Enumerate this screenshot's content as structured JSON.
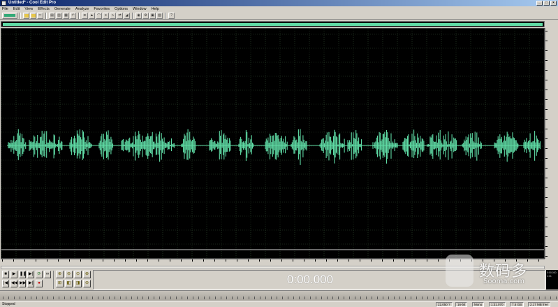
{
  "window": {
    "title": "Untitled* - Cool Edit Pro"
  },
  "menu": [
    "File",
    "Edit",
    "View",
    "Effects",
    "Generate",
    "Analyze",
    "Favorites",
    "Options",
    "Window",
    "Help"
  ],
  "toolbar": {
    "buttons": [
      "wave-view-icon",
      "open-icon",
      "save-icon",
      "cut-icon",
      "copy-icon",
      "paste-icon",
      "mix-paste-icon",
      "undo-icon",
      "trim-icon",
      "amplify-icon",
      "envelope-icon",
      "normalize-icon",
      "noise-reduction-icon",
      "reverse-icon",
      "fade-icon",
      "cd-player-icon",
      "settings-icon",
      "spectral-icon",
      "filter-icon",
      "help-icon"
    ]
  },
  "colors": {
    "waveform": "#5fdba5",
    "background": "#000000",
    "grid": "#2f4a2f",
    "time_display": "#ffffff"
  },
  "transport": {
    "row1": [
      "stop-icon",
      "play-icon",
      "pause-icon",
      "play-to-end-icon",
      "loop-icon",
      "repeat-icon"
    ],
    "row2": [
      "rewind-start-icon",
      "rewind-icon",
      "fast-forward-icon",
      "forward-end-icon",
      "record-icon"
    ]
  },
  "zoom": [
    "zoom-in-h-icon",
    "zoom-out-h-icon",
    "zoom-full-icon",
    "zoom-in-v-icon",
    "zoom-sel-icon",
    "zoom-left-icon",
    "zoom-right-icon",
    "zoom-out-v-icon"
  ],
  "time_display": "0:00.000",
  "selection_panel": {
    "line1": "0:00.000",
    "line2": "1:31"
  },
  "status": {
    "state": "Stopped",
    "sample_rate": "22,050 ?",
    "bits": "16-bit",
    "mode": "Mono",
    "duration": "1:31.070",
    "free_space": "7.5 GB",
    "disk": "2.17 MB free"
  },
  "watermark": {
    "cn": "数码多",
    "en": "Sooma.com"
  }
}
